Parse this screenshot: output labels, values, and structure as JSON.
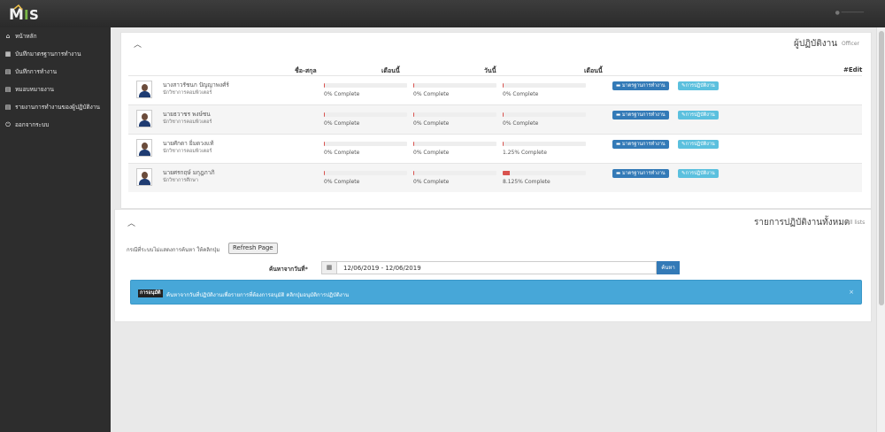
{
  "app": {
    "logo_text": "MIS"
  },
  "sidebar": {
    "items": [
      {
        "icon": "home-icon",
        "glyph": "⌂",
        "label": "หน้าหลัก"
      },
      {
        "icon": "grid-icon",
        "glyph": "▦",
        "label": "บันทึกมาตรฐานการทำงาน"
      },
      {
        "icon": "book-icon",
        "glyph": "▤",
        "label": "บันทึกการทำงาน"
      },
      {
        "icon": "book-icon",
        "glyph": "▤",
        "label": "หมอบหมายงาน"
      },
      {
        "icon": "book-icon",
        "glyph": "▤",
        "label": "รายงานการทำงานของผู้ปฏิบัติงาน"
      },
      {
        "icon": "logout-icon",
        "glyph": "⏻",
        "label": "ออกจากระบบ"
      }
    ]
  },
  "officer_panel": {
    "title": "ผู้ปฏิบัติงาน",
    "subtitle": "Officer",
    "headers": {
      "name": "ชื่อ-สกุล",
      "month": "เดือนนี้",
      "day": "วันนี้",
      "month2": "เดือนนี้",
      "edit": "#Edit"
    },
    "rows": [
      {
        "name": "นางสาวรัชนก ปัญญาพงศ์ร์",
        "position": "นักวิชาการคอมพิวเตอร์",
        "progress": [
          {
            "label": "0% Complete",
            "value": 0
          },
          {
            "label": "0% Complete",
            "value": 0
          },
          {
            "label": "0% Complete",
            "value": 0
          }
        ]
      },
      {
        "name": "นายธวาชร พงษ์ชน",
        "position": "นักวิชาการคอมพิวเตอร์",
        "progress": [
          {
            "label": "0% Complete",
            "value": 0
          },
          {
            "label": "0% Complete",
            "value": 0
          },
          {
            "label": "0% Complete",
            "value": 0
          }
        ]
      },
      {
        "name": "นายศักดา ยิ่มดวงแท้",
        "position": "นักวิชาการคอมพิวเตอร์",
        "progress": [
          {
            "label": "0% Complete",
            "value": 0
          },
          {
            "label": "0% Complete",
            "value": 0
          },
          {
            "label": "1.25% Complete",
            "value": 1.25
          }
        ]
      },
      {
        "name": "นายศรกฤษ์ มกุฎภาภิ",
        "position": "นักวิชาการศึกษา",
        "progress": [
          {
            "label": "0% Complete",
            "value": 0
          },
          {
            "label": "0% Complete",
            "value": 0
          },
          {
            "label": "8.125% Complete",
            "value": 8.125
          }
        ]
      }
    ],
    "std_button_label": "มาตรฐานการทำงาน",
    "duty_button_label": "การปฏิบัติงาน"
  },
  "list_panel": {
    "title": "รายการปฏิบัติงานทั้งหมด",
    "subtitle": "All lists",
    "hint": "กรณีที่ระบบไม่แสดงการค้นหา ให้คลิกปุ่ม",
    "refresh_label": "Refresh Page",
    "search_label": "ค้นหาจากวันที่*",
    "date_value": "12/06/2019 - 12/06/2019",
    "search_button": "ค้นหา",
    "alert_badge": "การอนุมัติ",
    "alert_text": "ค้นหาจากวันที่ปฏิบัติงานเพื่อรายการที่ต้องการอนุมัติ คลิกปุ่มอนุมัติการปฏิบัติงาน",
    "alert_close": "×"
  }
}
